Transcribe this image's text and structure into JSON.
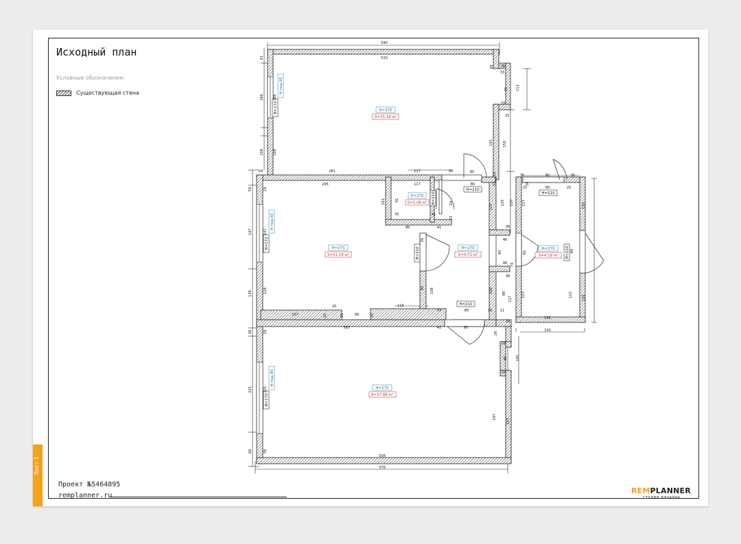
{
  "sheet": {
    "title": "Исходный план",
    "legend_caption": "Условные обозначения:",
    "legend_item": "Существующая стена",
    "project": "Проект №5464895",
    "website": "remplanner.ru",
    "sheet_label": "Лист 1",
    "brand_part1": "REM",
    "brand_part2": "PLANNER",
    "brand_subtitle": "СТУДИЯ ДИЗАЙНА"
  },
  "rooms": [
    {
      "height": "H=270",
      "area": "S=15.18 м²"
    },
    {
      "height": "H=270",
      "area": "S=1.06 м²"
    },
    {
      "height": "H=270",
      "area": "S=11.19 м²"
    },
    {
      "height": "H=270",
      "area": "S=4.71 м²"
    },
    {
      "height": "H=270",
      "area": "S=4.19 м²"
    },
    {
      "height": "H=270",
      "area": "S=17.88 м²"
    }
  ],
  "doors": [
    "H=210",
    "H=210",
    "H=210",
    "H=210",
    "H=210",
    "H=210"
  ],
  "windows": [
    {
      "label": "H=172",
      "sill": "H под.85"
    },
    {
      "label": "H=172",
      "sill": "H под.85"
    },
    {
      "label": "H=170",
      "sill": "H под.85"
    }
  ],
  "dims": {
    "top_outer": "540",
    "top_inner": "520",
    "bottom_outer": "576",
    "bottom_inner": "556",
    "mid_392": "392",
    "mid_295": "295",
    "mid_281": "281",
    "mid_117": "117",
    "mid_117b": "117",
    "mid_157": "157",
    "mid_89": "89",
    "mid_115": "115",
    "mid_42": "42",
    "mid_43": "43",
    "mid_80a": "80",
    "mid_80b": "80",
    "mid_80c": "80",
    "mid_80d": "80",
    "mid_80e": "80",
    "mid_30": "30",
    "mid_30b": "30",
    "mid_20": "20",
    "mid_20b": "20",
    "mid_20c": "20",
    "mid_20d": "20",
    "mid_76": "76",
    "mid_86": "86",
    "mid_41": "41",
    "mid_41b": "41",
    "mid_91": "91",
    "mid_101": "101",
    "left_41": "41",
    "left_186": "186",
    "left_109": "109",
    "left_24": "24",
    "left_59": "59",
    "left_147": "147",
    "left_139": "139",
    "left_38": "38",
    "left_225": "225",
    "left_68": "68",
    "in_186": "186",
    "in_109": "109",
    "in_147": "147",
    "in_128": "128",
    "in_225": "225",
    "in_58": "58",
    "in_18": "18",
    "in_19": "19",
    "right_36": "36",
    "right_33": "33",
    "right_111": "111",
    "right_91": "91",
    "right_33b": "33",
    "right_33c": "33",
    "right_150": "150",
    "right_161": "161",
    "right_129": "129",
    "right_129b": "129",
    "right_36b": "36",
    "right_40": "40",
    "right_46": "46",
    "right_36c": "36",
    "right_99": "99",
    "right_109": "109",
    "right_127": "127",
    "right_11": "11",
    "right_29": "29",
    "right_28": "28",
    "right_22": "22",
    "right_85": "85",
    "right_105": "105",
    "right_22b": "22",
    "right_197": "197",
    "right_197b": "197",
    "bath_35": "35",
    "bath_80": "80",
    "bath_35b": "35",
    "bath_117": "117",
    "bath_130": "130",
    "bath_123": "123",
    "bath_122": "122",
    "bath_132": "132",
    "bath_130b": "130",
    "bath_150": "150",
    "bath_82": "82",
    "bath_80b": "80",
    "bath_16": "16",
    "bath_25": "25",
    "bath_25b": "25",
    "bath_80c": "80",
    "bath_120": "120",
    "bath_74": "74",
    "cor_108": "108",
    "cor_90": "90",
    "cor_85": "85",
    "cor_36": "36",
    "cor_13": "13",
    "cor_12": "12",
    "wc_24": "24",
    "wc_39": "39",
    "wc_23": "23",
    "wc_36": "36"
  }
}
